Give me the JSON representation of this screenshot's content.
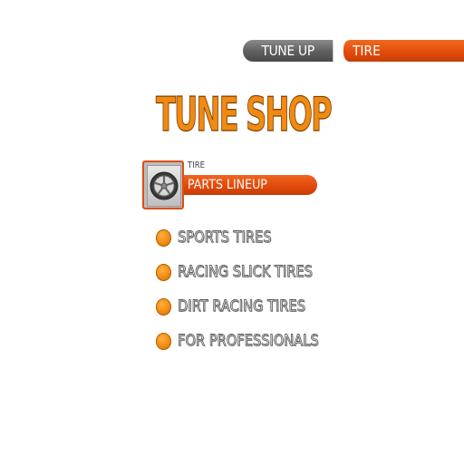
{
  "header": {
    "tab_tuneup": "TUNE UP",
    "tab_tire": "TIRE"
  },
  "title": "TUNE SHOP",
  "section": {
    "small_label": "TIRE",
    "bar_label": "PARTS LINEUP",
    "icon": "tire-wheel-icon"
  },
  "menu": {
    "items": [
      {
        "label": "SPORTS TIRES"
      },
      {
        "label": "RACING SLICK TIRES"
      },
      {
        "label": "DIRT RACING TIRES"
      },
      {
        "label": "FOR PROFESSIONALS"
      }
    ],
    "bullet_icon": "orange-dot-icon"
  },
  "colors": {
    "accent_orange": "#e24c10",
    "title_orange": "#f08a12",
    "tab_gray": "#5e5e5e",
    "bullet_orange": "#f08a10"
  }
}
